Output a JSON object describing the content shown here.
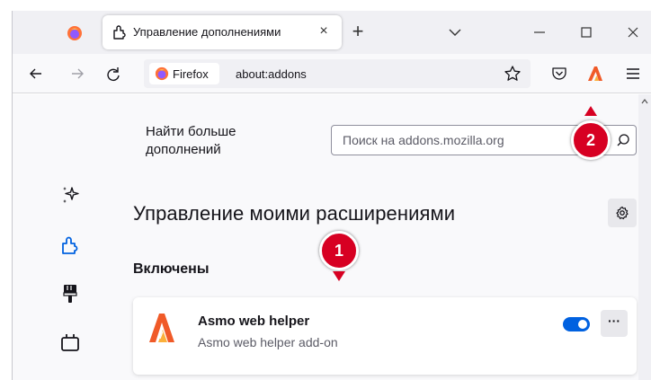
{
  "tab": {
    "title": "Управление дополнениями",
    "close": "×"
  },
  "tabstrip": {
    "new_tab": "+"
  },
  "urlbar": {
    "identity_label": "Firefox",
    "url": "about:addons"
  },
  "content": {
    "find_more": "Найти больше дополнений",
    "search_placeholder": "Поиск на addons.mozilla.org",
    "heading": "Управление моими расширениями",
    "section": "Включены"
  },
  "addon": {
    "name": "Asmo web helper",
    "description": "Asmo web helper add-on",
    "enabled": true,
    "more": "···"
  },
  "callouts": {
    "marker1": "1",
    "marker2": "2"
  },
  "colors": {
    "accent": "#0061e0",
    "marker": "#d70022"
  }
}
